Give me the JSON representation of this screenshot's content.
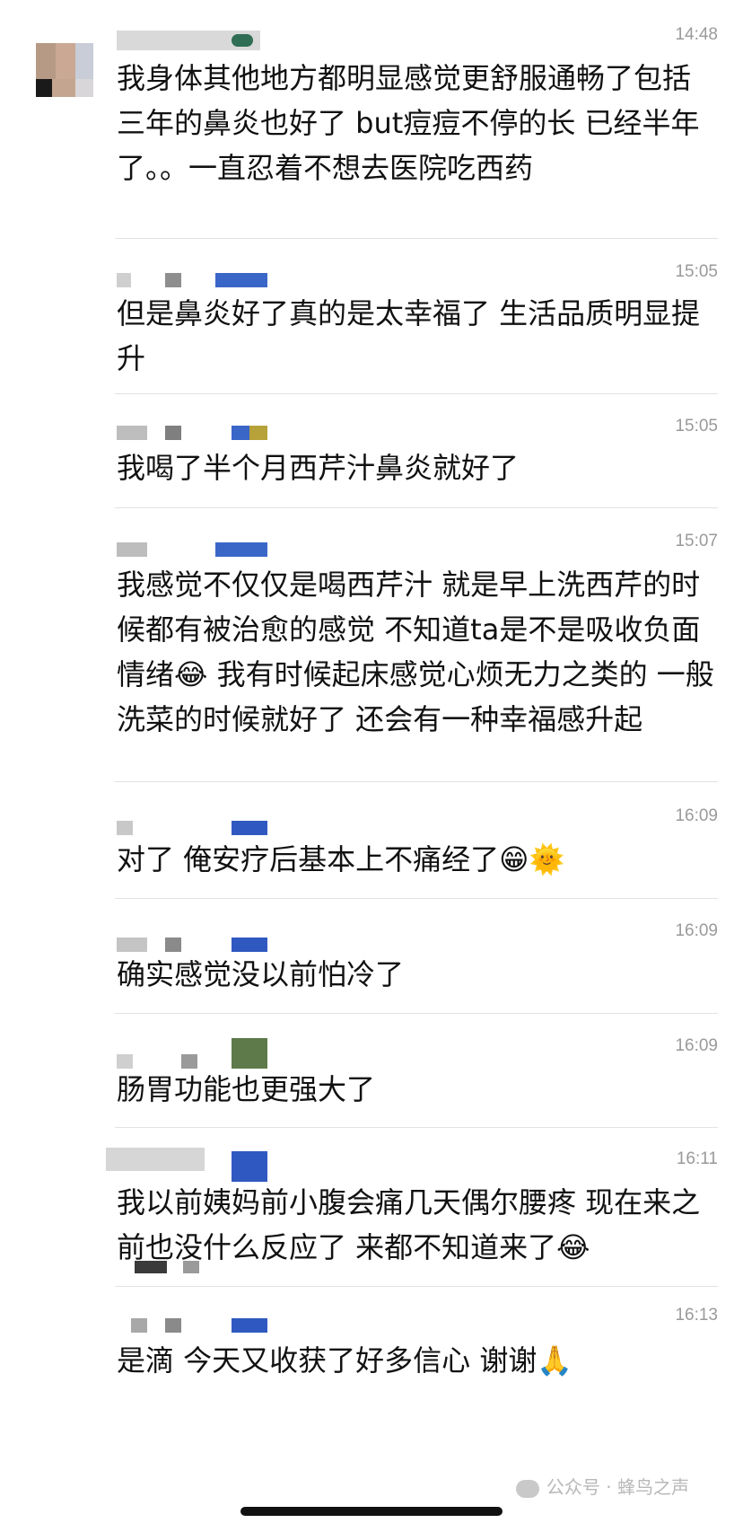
{
  "comments": [
    {
      "time": "14:48",
      "text": "我身体其他地方都明显感觉更舒服通畅了包括三年的鼻炎也好了 but痘痘不停的长 已经半年了。。一直忍着不想去医院吃西药"
    },
    {
      "time": "15:05",
      "text": "但是鼻炎好了真的是太幸福了 生活品质明显提升"
    },
    {
      "time": "15:05",
      "text": "我喝了半个月西芹汁鼻炎就好了"
    },
    {
      "time": "15:07",
      "text": "我感觉不仅仅是喝西芹汁 就是早上洗西芹的时候都有被治愈的感觉 不知道ta是不是吸收负面情绪😂 我有时候起床感觉心烦无力之类的 一般洗菜的时候就好了 还会有一种幸福感升起"
    },
    {
      "time": "16:09",
      "text": "对了 俺安疗后基本上不痛经了😁🌞"
    },
    {
      "time": "16:09",
      "text": "确实感觉没以前怕冷了"
    },
    {
      "time": "16:09",
      "text": "肠胃功能也更强大了"
    },
    {
      "time": "16:11",
      "text": "我以前姨妈前小腹会痛几天偶尔腰疼 现在来之前也没什么反应了 来都不知道来了😂"
    },
    {
      "time": "16:13",
      "text": "是滴 今天又收获了好多信心 谢谢🙏"
    }
  ],
  "watermark": "公众号 · 蜂鸟之声",
  "colors": {
    "text": "#111111",
    "time": "#9a9a9a",
    "divider": "#e2e2e2",
    "blur_blue": "#3a66c8"
  }
}
